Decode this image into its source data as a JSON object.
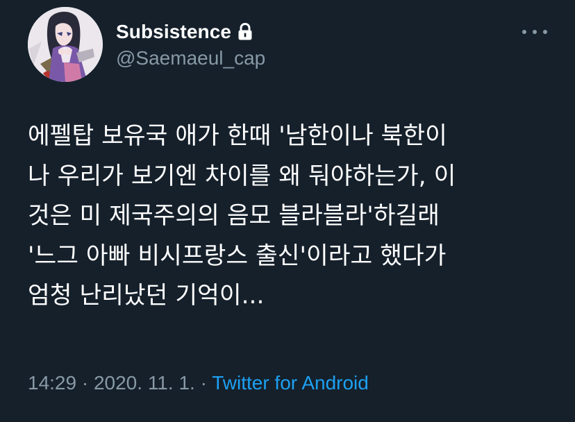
{
  "user": {
    "display_name": "Subsistence",
    "handle": "@Saemaeul_cap",
    "protected_icon": "lock-icon",
    "avatar": "anime-character-avatar"
  },
  "menu": {
    "icon": "more-horizontal-icon"
  },
  "tweet": {
    "lines": [
      "에펠탑 보유국 애가 한때 '남한이나 북한이",
      "나 우리가 보기엔 차이를 왜 둬야하는가, 이",
      "것은 미 제국주의의 음모 블라블라'하길래",
      "'느그 아빠 비시프랑스 출신'이라고 했다가",
      "엄청 난리났던 기억이..."
    ]
  },
  "meta": {
    "time": "14:29",
    "separator": "·",
    "date": "2020. 11. 1.",
    "source": "Twitter for Android"
  },
  "colors": {
    "background": "#15202b",
    "primary_text": "#ffffff",
    "secondary_text": "#8899a6",
    "accent": "#1da1f2"
  }
}
